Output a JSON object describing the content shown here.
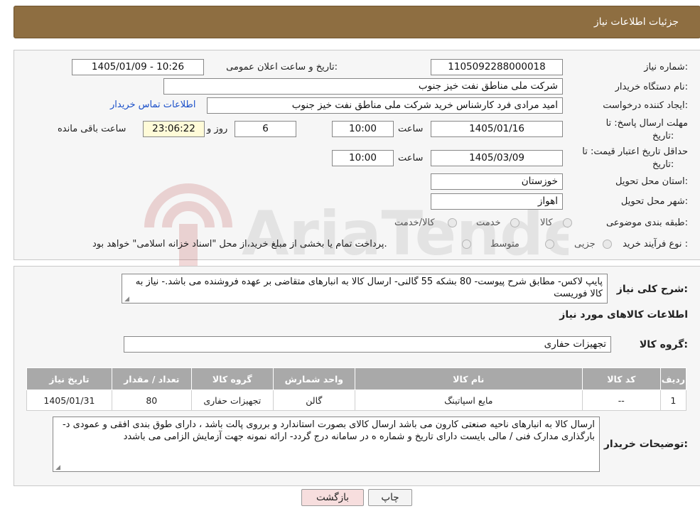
{
  "header": {
    "title": "جزئیات اطلاعات نیاز"
  },
  "fields": {
    "need_number_label": "شماره نیاز:",
    "need_number": "1105092288000018",
    "announce_label": "تاریخ و ساعت اعلان عمومی:",
    "announce_value": "1405/01/09 - 10:26",
    "buyer_org_label": "نام دستگاه خریدار:",
    "buyer_org": "شرکت ملی مناطق نفت خیز جنوب",
    "creator_label": "ایجاد کننده درخواست:",
    "creator": "امید مرادی فرد کارشناس خرید شرکت ملی مناطق نفت خیز جنوب",
    "contact_link": "اطلاعات تماس خریدار",
    "deadline_label_1": "مهلت ارسال پاسخ: تا",
    "deadline_label_2": "تاریخ:",
    "deadline_date": "1405/01/16",
    "time_label": "ساعت",
    "deadline_time": "10:00",
    "days": "6",
    "days_label": "روز و",
    "remaining": "23:06:22",
    "remaining_label": "ساعت باقی مانده",
    "validity_label_1": "حداقل تاریخ اعتبار قیمت: تا",
    "validity_label_2": "تاریخ:",
    "validity_date": "1405/03/09",
    "validity_time_label": "ساعت",
    "validity_time": "10:00",
    "province_label": "استان محل تحویل:",
    "province": "خوزستان",
    "city_label": "شهر محل تحویل:",
    "city": "اهواز",
    "category_label": "طبقه بندی موضوعی:",
    "category_options": [
      "کالا",
      "خدمت",
      "کالا/خدمت"
    ],
    "process_label": "نوع فرآیند خرید :",
    "process_options": [
      "جزیی",
      "متوسط"
    ],
    "process_note": "پرداخت تمام یا بخشی از مبلغ خرید،از محل \"اسناد خزانه اسلامی\" خواهد بود."
  },
  "description": {
    "label": "شرح کلی نیاز:",
    "text": "پایپ لاکس- مطابق شرح پیوست- 80 بشکه 55 گالنی- ارسال کالا به انبارهای متقاضی بر عهده فروشنده می باشد.- نیاز به کالا فوریست",
    "goods_info_title": "اطلاعات کالاهای مورد نیاز",
    "goods_group_label": "گروه کالا:",
    "goods_group": "تجهیزات حفاری"
  },
  "table": {
    "headers": [
      "ردیف",
      "کد کالا",
      "نام کالا",
      "واحد شمارش",
      "گروه کالا",
      "تعداد / مقدار",
      "تاریخ نیاز"
    ],
    "rows": [
      [
        "1",
        "--",
        "مایع اسپاتینگ",
        "گالن",
        "تجهیزات حفاری",
        "80",
        "1405/01/31"
      ]
    ]
  },
  "buyer_notes": {
    "label": "توضیحات خریدار:",
    "text": "ارسال کالا به انبارهای ناحیه صنعتی  کارون می باشد   ارسال کالای بصورت استاندارد و برروی پالت باشد ، دارای طوق بندی افقی و عمودی د-بارگذاری مدارک فنی / مالی بایست دارای تاریخ و شماره ه در سامانه درج گردد- ارائه نمونه جهت آزمایش الزامی می باشدد"
  },
  "buttons": {
    "print": "چاپ",
    "back": "بازگشت"
  },
  "watermark": {
    "text": "AriaTender.neT"
  },
  "colors": {
    "header_bg": "#8e6e41",
    "link": "#1a4fc9",
    "table_header": "#a9a9a9",
    "back_button": "#f7dede",
    "remaining_bg": "#fffbd8"
  }
}
